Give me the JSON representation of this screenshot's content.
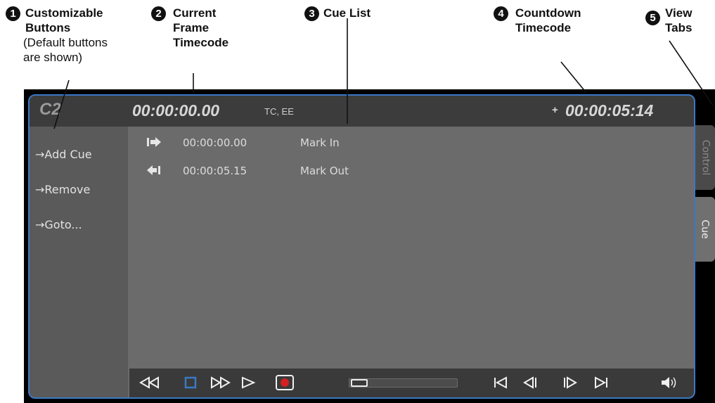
{
  "callouts": [
    {
      "num": "1",
      "title": [
        "Customizable",
        "Buttons"
      ],
      "sub": [
        "(Default buttons",
        "are shown)"
      ]
    },
    {
      "num": "2",
      "title": [
        "Current",
        "Frame",
        "Timecode"
      ],
      "sub": []
    },
    {
      "num": "3",
      "title": [
        "Cue List"
      ],
      "sub": []
    },
    {
      "num": "4",
      "title": [
        "Countdown",
        "Timecode"
      ],
      "sub": []
    },
    {
      "num": "5",
      "title": [
        "View",
        "Tabs"
      ],
      "sub": []
    }
  ],
  "header": {
    "channel_id": "C2",
    "current_timecode": "00:00:00.00",
    "timecode_source": "TC, EE",
    "countdown_arrow": "+",
    "countdown_timecode": "00:00:05:14"
  },
  "buttons": [
    {
      "label": "→Add Cue"
    },
    {
      "label": "→Remove"
    },
    {
      "label": "→Goto..."
    }
  ],
  "cue_list": [
    {
      "icon": "mark-in-icon",
      "timecode": "00:00:00.00",
      "name": "Mark In"
    },
    {
      "icon": "mark-out-icon",
      "timecode": "00:00:05.15",
      "name": "Mark Out"
    }
  ],
  "transport": {
    "controls": [
      "rewind",
      "stop",
      "fast-forward",
      "play",
      "record",
      "go-to-start",
      "step-back",
      "step-forward",
      "go-to-end",
      "volume"
    ],
    "position": 0.0
  },
  "tabs": [
    {
      "label": "Control",
      "selected": false
    },
    {
      "label": "Cue",
      "selected": true
    }
  ],
  "colors": {
    "accent": "#3b78c4",
    "record": "#d42020",
    "stop": "#3b78c4"
  }
}
